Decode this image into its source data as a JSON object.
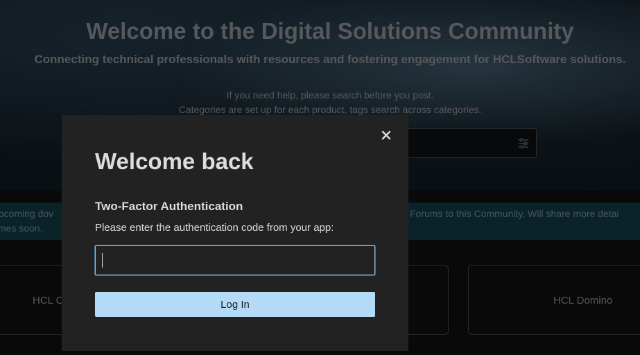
{
  "page": {
    "title": "Welcome to the Digital Solutions Community",
    "subtitle": "Connecting technical professionals with resources and fostering engagement for HCLSoftware solutions.",
    "help_line_1": "If you need help, please search before you post.",
    "help_line_2": "Categories are set up for each product, tags search across categories.",
    "banner_left_line_1": "upcoming dov",
    "banner_left_line_2": "times soon.",
    "banner_right": "Forums to this Community. Will share more detai",
    "card_left_label": "HCL C",
    "card_right_label": "HCL Domino"
  },
  "modal": {
    "title": "Welcome back",
    "tfa_heading": "Two-Factor Authentication",
    "tfa_instructions": "Please enter the authentication code from your app:",
    "code_value": "",
    "login_label": "Log In",
    "close_symbol": "×"
  },
  "colors": {
    "modal_bg": "#222222",
    "primary_button": "#b3dbf8",
    "input_focus": "#8fc3e8",
    "banner_bg": "#0b2b33"
  },
  "icons": [
    "close-icon",
    "filter-sliders-icon"
  ]
}
